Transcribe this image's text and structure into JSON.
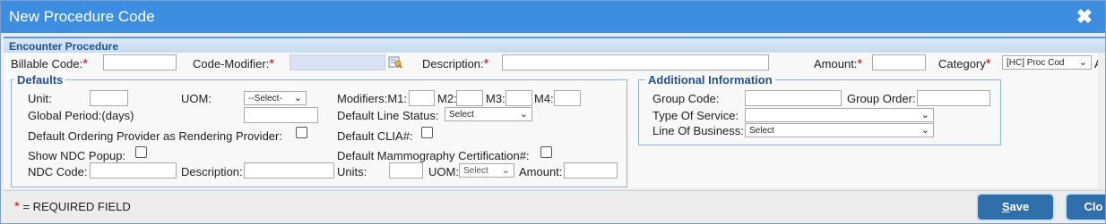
{
  "dialog": {
    "title": "New Procedure Code",
    "close_glyph": "✖"
  },
  "section": {
    "title": "Encounter Procedure"
  },
  "row1": {
    "billable_code_label": "Billable Code:",
    "code_modifier_label": "Code-Modifier:",
    "description_label": "Description:",
    "amount_label": "Amount:",
    "category_label": "Category",
    "category_value": "[HC] Proc Cod",
    "overflow_text": "Ac",
    "required_mark": "*"
  },
  "defaults": {
    "legend": "Defaults",
    "unit_label": "Unit:",
    "uom_label": "UOM:",
    "uom_value": "--Select-",
    "modifiers_label": "Modifiers:M1:",
    "m2_label": "M2:",
    "m3_label": "M3:",
    "m4_label": "M4:",
    "global_period_label": "Global Period:(days)",
    "default_line_status_label": "Default Line Status:",
    "default_line_status_value": "Select",
    "ordering_provider_label": "Default Ordering Provider as Rendering Provider:",
    "default_clia_label": "Default CLIA#:",
    "show_ndc_popup_label": "Show NDC Popup:",
    "default_mammography_label": "Default Mammography Certification#:",
    "ndc_code_label": "NDC Code:",
    "description_label": "Description:",
    "units_label": "Units:",
    "uom2_label": "UOM:",
    "uom2_value": "Select",
    "amount_label": "Amount:"
  },
  "additional": {
    "legend": "Additional Information",
    "group_code_label": "Group Code:",
    "group_order_label": "Group Order:",
    "type_of_service_label": "Type Of Service:",
    "type_of_service_value": "",
    "line_of_business_label": "Line Of Business:",
    "line_of_business_value": "Select"
  },
  "footer": {
    "required_star": "*",
    "required_text": " = REQUIRED FIELD",
    "save_first": "S",
    "save_rest": "ave",
    "close_label": "Clo"
  },
  "icons": {
    "lookup": "lookup-icon",
    "close": "close-icon",
    "chevron": "chevron-down-icon"
  },
  "colors": {
    "titlebar": "#3d8ee0",
    "section_text": "#25518f",
    "required": "#d01010",
    "button": "#2f6fab"
  }
}
